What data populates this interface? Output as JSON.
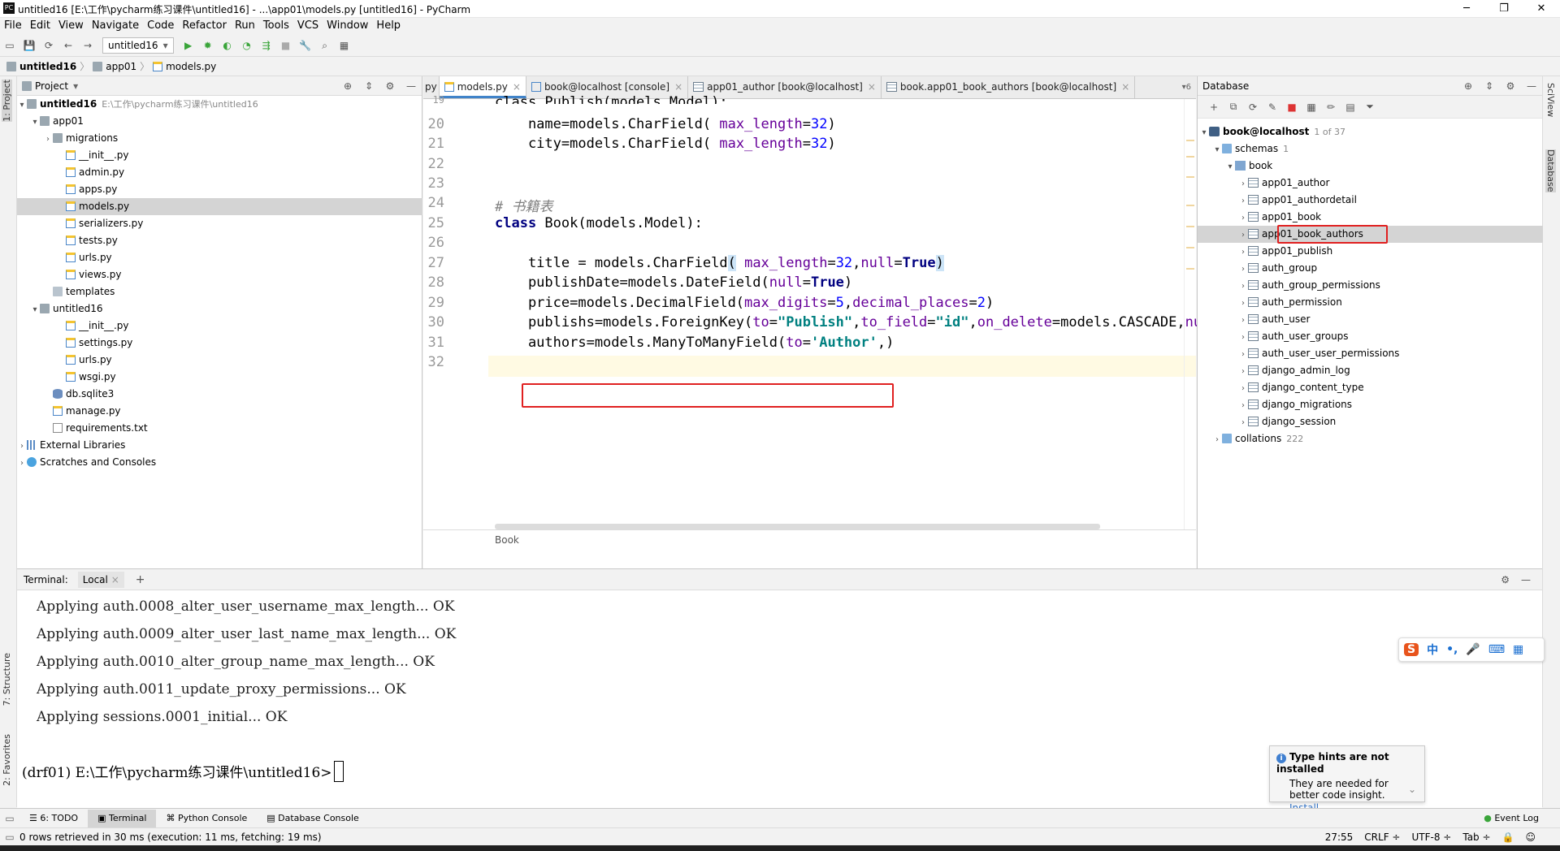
{
  "window": {
    "title": "untitled16 [E:\\工作\\pycharm练习课件\\untitled16] - ...\\app01\\models.py [untitled16] - PyCharm",
    "minimize": "─",
    "maximize": "❐",
    "close": "✕"
  },
  "menu": [
    "File",
    "Edit",
    "View",
    "Navigate",
    "Code",
    "Refactor",
    "Run",
    "Tools",
    "VCS",
    "Window",
    "Help"
  ],
  "toolbar": {
    "run_config": "untitled16"
  },
  "breadcrumb": [
    "untitled16",
    "app01",
    "models.py"
  ],
  "left_stripe": {
    "project_tab": "1: Project",
    "structure_tab": "7: Structure",
    "favorites_tab": "2: Favorites"
  },
  "right_stripe": {
    "sciview_tab": "SciView",
    "database_tab": "Database"
  },
  "project_panel": {
    "title": "Project",
    "tree": [
      {
        "label": "untitled16",
        "extra": "E:\\工作\\pycharm练习课件\\untitled16",
        "bold": true
      },
      {
        "label": "app01"
      },
      {
        "label": "migrations"
      },
      {
        "label": "__init__.py"
      },
      {
        "label": "admin.py"
      },
      {
        "label": "apps.py"
      },
      {
        "label": "models.py"
      },
      {
        "label": "serializers.py"
      },
      {
        "label": "tests.py"
      },
      {
        "label": "urls.py"
      },
      {
        "label": "views.py"
      },
      {
        "label": "templates"
      },
      {
        "label": "untitled16"
      },
      {
        "label": "__init__.py"
      },
      {
        "label": "settings.py"
      },
      {
        "label": "urls.py"
      },
      {
        "label": "wsgi.py"
      },
      {
        "label": "db.sqlite3"
      },
      {
        "label": "manage.py"
      },
      {
        "label": "requirements.txt"
      },
      {
        "label": "External Libraries"
      },
      {
        "label": "Scratches and Consoles"
      }
    ]
  },
  "editor": {
    "tabs": [
      {
        "label": "py",
        "active": false
      },
      {
        "label": "models.py",
        "active": true
      },
      {
        "label": "book@localhost [console]",
        "active": false
      },
      {
        "label": "app01_author [book@localhost]",
        "active": false
      },
      {
        "label": "book.app01_book_authors [book@localhost]",
        "active": false
      }
    ],
    "tab_overflow": "6",
    "line_numbers": [
      "20",
      "21",
      "22",
      "23",
      "24",
      "25",
      "26",
      "27",
      "28",
      "29",
      "30",
      "31",
      "32"
    ],
    "lines": {
      "l19": "class Publish(models.Model):",
      "l20": "    name=models.CharField( max_length=32)",
      "l21": "    city=models.CharField( max_length=32)",
      "l24": "# 书籍表",
      "l25": "class Book(models.Model):",
      "l27": "    title = models.CharField( max_length=32,null=True)",
      "l28": "    publishDate=models.DateField(null=True)",
      "l29": "    price=models.DecimalField(max_digits=5,decimal_places=2)",
      "l30": "    publishs=models.ForeignKey(to=\"Publish\",to_field=\"id\",on_delete=models.CASCADE,nul",
      "l31": "    authors=models.ManyToManyField(to='Author',)"
    },
    "crumb": "Book"
  },
  "database_panel": {
    "title": "Database",
    "host": "book@localhost",
    "host_count": "1 of 37",
    "schemas_label": "schemas",
    "schemas_count": "1",
    "schema": "book",
    "tables": [
      "app01_author",
      "app01_authordetail",
      "app01_book",
      "app01_book_authors",
      "app01_publish",
      "auth_group",
      "auth_group_permissions",
      "auth_permission",
      "auth_user",
      "auth_user_groups",
      "auth_user_user_permissions",
      "django_admin_log",
      "django_content_type",
      "django_migrations",
      "django_session"
    ],
    "collations_label": "collations",
    "collations_count": "222"
  },
  "terminal": {
    "label": "Terminal:",
    "tab": "Local",
    "lines": [
      "Applying auth.0008_alter_user_username_max_length... OK",
      "Applying auth.0009_alter_user_last_name_max_length... OK",
      "Applying auth.0010_alter_group_name_max_length... OK",
      "Applying auth.0011_update_proxy_permissions... OK",
      "Applying sessions.0001_initial... OK"
    ],
    "prompt": "(drf01) E:\\工作\\pycharm练习课件\\untitled16>"
  },
  "ime": {
    "logo": "S",
    "items": [
      "中",
      "•,",
      "🎤",
      "⌨",
      "▦"
    ]
  },
  "notification": {
    "title": "Type hints are not installed",
    "body": "They are needed for better code insight.",
    "action": "Install..."
  },
  "tool_windows": {
    "todo": "6: TODO",
    "terminal": "Terminal",
    "python_console": "Python Console",
    "database_console": "Database Console",
    "event_log": "Event Log"
  },
  "status": {
    "message": "0 rows retrieved in 30 ms (execution: 11 ms, fetching: 19 ms)",
    "position": "27:55",
    "line_sep": "CRLF ÷",
    "encoding": "UTF-8 ÷",
    "indent": "Tab ÷"
  }
}
